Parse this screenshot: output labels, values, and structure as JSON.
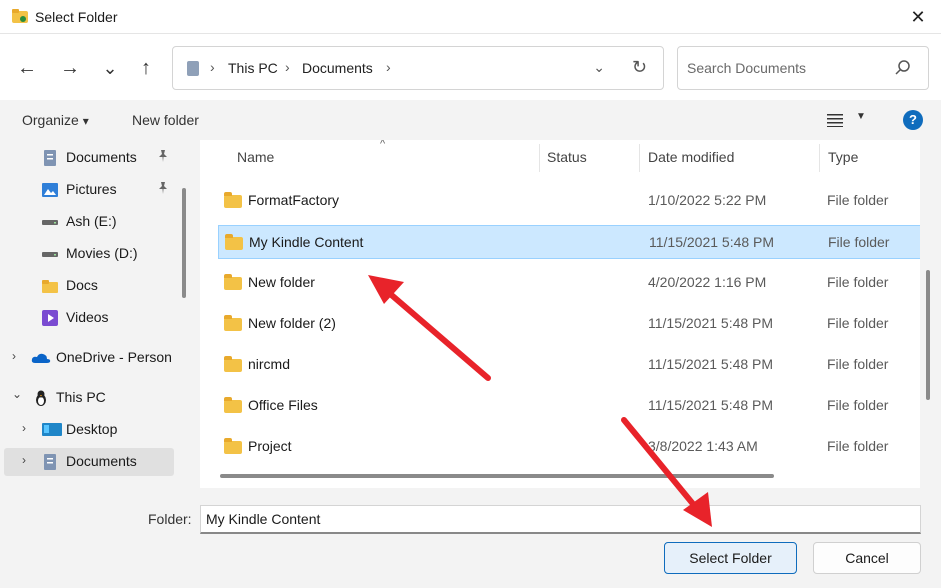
{
  "window": {
    "title": "Select Folder",
    "close_glyph": "✕"
  },
  "nav": {
    "back_glyph": "←",
    "forward_glyph": "→",
    "recent_glyph": "⌄",
    "up_glyph": "↑"
  },
  "address": {
    "crumbs": [
      "This PC",
      "Documents"
    ],
    "separator": "›",
    "dropdown_glyph": "⌄",
    "refresh_glyph": "↻"
  },
  "search": {
    "placeholder": "Search Documents"
  },
  "toolbar": {
    "organize_label": "Organize",
    "organize_caret": "▾",
    "new_folder_label": "New folder",
    "view_caret": "▼",
    "help_label": "?"
  },
  "sidebar": {
    "pin_glyph": "📌",
    "chevron_right": "›",
    "chevron_down": "⌄",
    "items": [
      {
        "label": "Documents",
        "icon": "document-icon"
      },
      {
        "label": "Pictures",
        "icon": "pictures-icon"
      },
      {
        "label": "Ash (E:)",
        "icon": "drive-icon"
      },
      {
        "label": "Movies (D:)",
        "icon": "drive-icon"
      },
      {
        "label": "Docs",
        "icon": "folder-icon"
      },
      {
        "label": "Videos",
        "icon": "videos-icon"
      },
      {
        "label": "OneDrive - Person",
        "icon": "onedrive-icon"
      },
      {
        "label": "This PC",
        "icon": "this-pc-icon"
      },
      {
        "label": "Desktop",
        "icon": "desktop-icon"
      },
      {
        "label": "Documents",
        "icon": "document-icon"
      }
    ]
  },
  "files": {
    "columns": [
      "Name",
      "Status",
      "Date modified",
      "Type"
    ],
    "sort_caret": "^",
    "rows": [
      {
        "name": "FormatFactory",
        "date": "1/10/2022 5:22 PM",
        "type": "File folder"
      },
      {
        "name": "My Kindle Content",
        "date": "11/15/2021 5:48 PM",
        "type": "File folder"
      },
      {
        "name": "New folder",
        "date": "4/20/2022 1:16 PM",
        "type": "File folder"
      },
      {
        "name": "New folder (2)",
        "date": "11/15/2021 5:48 PM",
        "type": "File folder"
      },
      {
        "name": "nircmd",
        "date": "11/15/2021 5:48 PM",
        "type": "File folder"
      },
      {
        "name": "Office Files",
        "date": "11/15/2021 5:48 PM",
        "type": "File folder"
      },
      {
        "name": "Project",
        "date": "3/8/2022 1:43 AM",
        "type": "File folder"
      }
    ],
    "selected_index": 1
  },
  "footer": {
    "folder_label": "Folder:",
    "folder_value": "My Kindle Content",
    "select_label": "Select Folder",
    "cancel_label": "Cancel"
  },
  "colors": {
    "accent": "#0f6cbd",
    "selection": "#cce8ff",
    "folder": "#f3c246",
    "annotation_arrow": "#e8232a"
  }
}
